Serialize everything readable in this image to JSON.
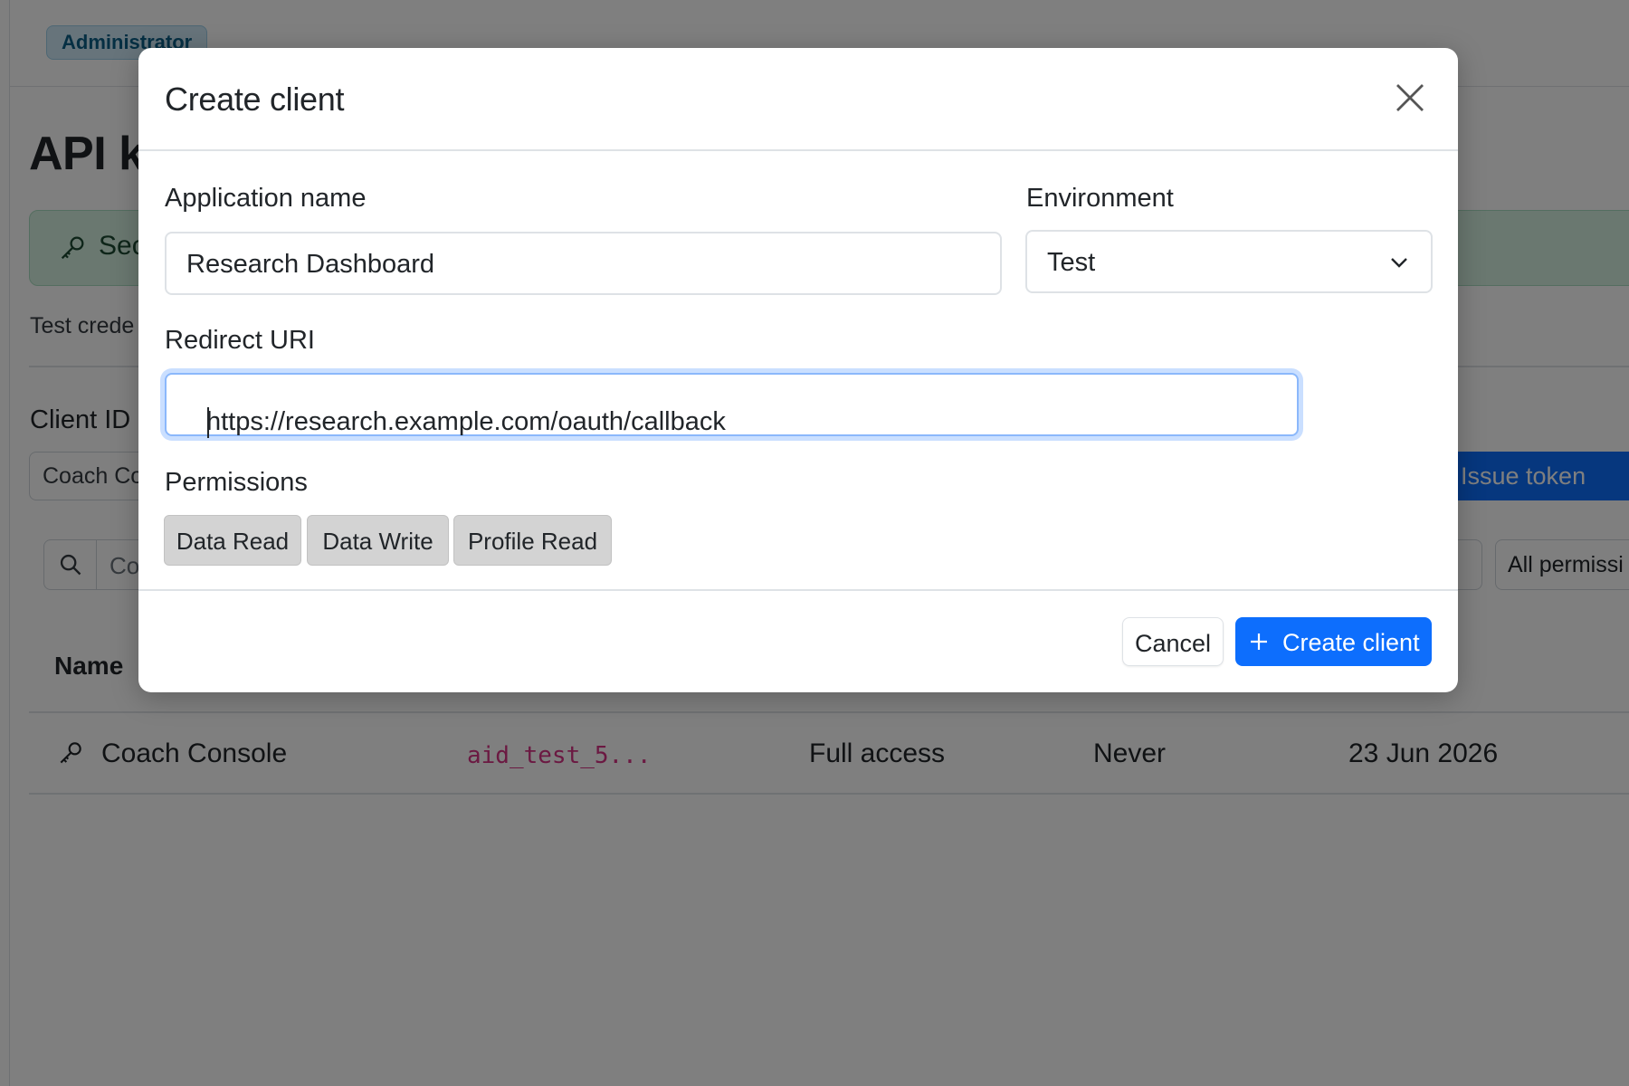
{
  "background_page": {
    "role_badge": "Administrator",
    "title": "API k",
    "secret_banner": {
      "icon": "key-icon",
      "text": "Sec"
    },
    "test_note": "Test crede",
    "client_id_label": "Client ID",
    "client_id_value": "Coach Co",
    "issue_token_label": "Issue token",
    "search_text": "Co",
    "permission_filter": "All permissi",
    "table": {
      "name_header": "Name",
      "rows": [
        {
          "icon": "key-icon",
          "name": "Coach Console",
          "client_id": "aid_test_5...",
          "access": "Full access",
          "expires": "Never",
          "date": "23 Jun 2026"
        }
      ]
    }
  },
  "modal": {
    "title": "Create client",
    "close_icon": "close-icon",
    "application_name": {
      "label": "Application name",
      "value": "Research Dashboard"
    },
    "environment": {
      "label": "Environment",
      "value": "Test"
    },
    "redirect_uri": {
      "label": "Redirect URI",
      "value": "https://research.example.com/oauth/callback"
    },
    "permissions": {
      "label": "Permissions",
      "options": [
        "Data Read",
        "Data Write",
        "Profile Read"
      ]
    },
    "buttons": {
      "cancel": "Cancel",
      "create": "Create client"
    }
  },
  "colors": {
    "primary": "#0d6efd",
    "backdrop": "rgba(0,0,0,0.5)",
    "badge_bg": "#cfe8f7",
    "banner_bg": "#d5f0e0",
    "code_text": "#d63384",
    "chip_bg": "#d3d3d3"
  }
}
